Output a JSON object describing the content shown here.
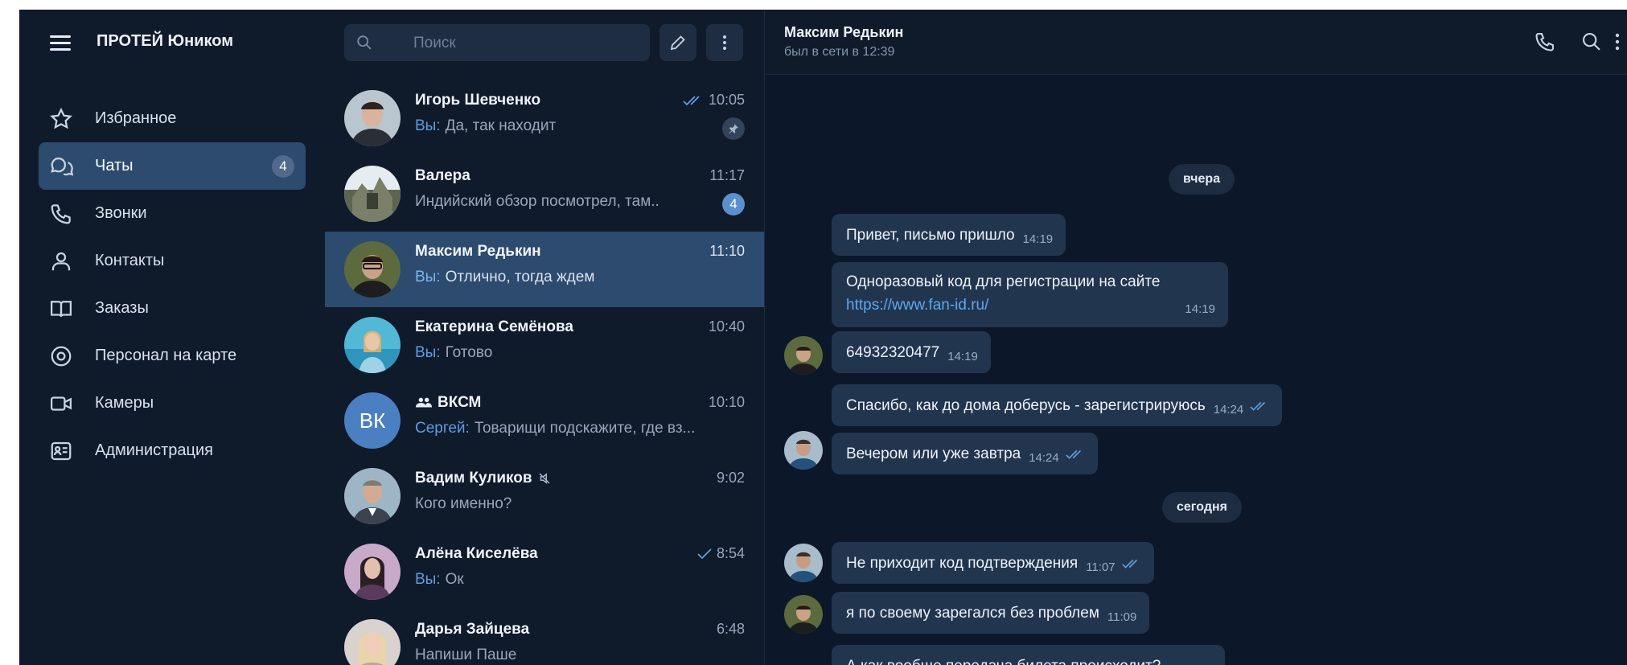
{
  "app": {
    "title": "ПРОТЕЙ Юником"
  },
  "nav": {
    "items": [
      {
        "label": "Избранное",
        "icon": "star-icon"
      },
      {
        "label": "Чаты",
        "icon": "chat-icon",
        "badge": "4"
      },
      {
        "label": "Звонки",
        "icon": "phone-icon"
      },
      {
        "label": "Контакты",
        "icon": "person-icon"
      },
      {
        "label": "Заказы",
        "icon": "book-icon"
      },
      {
        "label": "Персонал на карте",
        "icon": "map-pin-icon"
      },
      {
        "label": "Камеры",
        "icon": "camera-icon"
      },
      {
        "label": "Администрация",
        "icon": "id-card-icon"
      }
    ]
  },
  "search": {
    "placeholder": "Поиск"
  },
  "chats": [
    {
      "name": "Игорь Шевченко",
      "you": "Вы:",
      "preview": "Да, так находит",
      "time": "10:05",
      "pinned": true
    },
    {
      "name": "Валера",
      "preview": "Индийский обзор посмотрел, там..",
      "time": "11:17",
      "unread": "4"
    },
    {
      "name": "Максим Редькин",
      "you": "Вы:",
      "preview": "Отлично, тогда ждем",
      "time": "11:10"
    },
    {
      "name": "Екатерина Семёнова",
      "you": "Вы:",
      "preview": "Готово",
      "time": "10:40"
    },
    {
      "name": "ВКСМ",
      "initials": "ВК",
      "sender": "Сергей:",
      "preview": "Товарищи подскажите, где вз...",
      "time": "10:10"
    },
    {
      "name": "Вадим Куликов",
      "preview": "Кого именно?",
      "time": "9:02"
    },
    {
      "name": "Алёна Киселёва",
      "you": "Вы:",
      "preview": "Ок",
      "time": "8:54"
    },
    {
      "name": "Дарья Зайцева",
      "preview": "Напиши Паше",
      "time": "6:48"
    }
  ],
  "conversation": {
    "name": "Максим Редькин",
    "status": "был в сети в 12:39",
    "days": [
      "вчера",
      "сегодня"
    ],
    "messages": [
      {
        "text": "Привет, письмо пришло",
        "time": "14:19"
      },
      {
        "text": "Одноразовый код для регистрации на сайте",
        "link": "https://www.fan-id.ru/",
        "time": "14:19"
      },
      {
        "text": "64932320477",
        "time": "14:19"
      },
      {
        "text": "Спасибо, как до дома доберусь - зарегистрируюсь",
        "time": "14:24"
      },
      {
        "text": "Вечером или уже завтра",
        "time": "14:24"
      },
      {
        "text": "Не приходит код подтверждения",
        "time": "11:07"
      },
      {
        "text": "я по своему зарегался без проблем",
        "time": "11:09"
      },
      {
        "text": "А как вообще передача билета происходит?"
      }
    ]
  },
  "colors": {
    "background": "#0f1a2b",
    "active": "#2d4a6f",
    "bubble": "#22354f",
    "accent": "#5c9ee0"
  }
}
